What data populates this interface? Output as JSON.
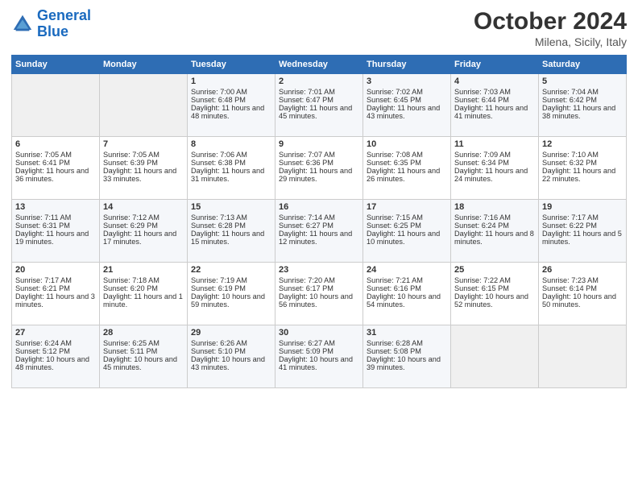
{
  "logo": {
    "line1": "General",
    "line2": "Blue"
  },
  "title": "October 2024",
  "subtitle": "Milena, Sicily, Italy",
  "days_of_week": [
    "Sunday",
    "Monday",
    "Tuesday",
    "Wednesday",
    "Thursday",
    "Friday",
    "Saturday"
  ],
  "weeks": [
    [
      {
        "day": "",
        "sunrise": "",
        "sunset": "",
        "daylight": "",
        "empty": true
      },
      {
        "day": "",
        "sunrise": "",
        "sunset": "",
        "daylight": "",
        "empty": true
      },
      {
        "day": "1",
        "sunrise": "Sunrise: 7:00 AM",
        "sunset": "Sunset: 6:48 PM",
        "daylight": "Daylight: 11 hours and 48 minutes.",
        "empty": false
      },
      {
        "day": "2",
        "sunrise": "Sunrise: 7:01 AM",
        "sunset": "Sunset: 6:47 PM",
        "daylight": "Daylight: 11 hours and 45 minutes.",
        "empty": false
      },
      {
        "day": "3",
        "sunrise": "Sunrise: 7:02 AM",
        "sunset": "Sunset: 6:45 PM",
        "daylight": "Daylight: 11 hours and 43 minutes.",
        "empty": false
      },
      {
        "day": "4",
        "sunrise": "Sunrise: 7:03 AM",
        "sunset": "Sunset: 6:44 PM",
        "daylight": "Daylight: 11 hours and 41 minutes.",
        "empty": false
      },
      {
        "day": "5",
        "sunrise": "Sunrise: 7:04 AM",
        "sunset": "Sunset: 6:42 PM",
        "daylight": "Daylight: 11 hours and 38 minutes.",
        "empty": false
      }
    ],
    [
      {
        "day": "6",
        "sunrise": "Sunrise: 7:05 AM",
        "sunset": "Sunset: 6:41 PM",
        "daylight": "Daylight: 11 hours and 36 minutes.",
        "empty": false
      },
      {
        "day": "7",
        "sunrise": "Sunrise: 7:05 AM",
        "sunset": "Sunset: 6:39 PM",
        "daylight": "Daylight: 11 hours and 33 minutes.",
        "empty": false
      },
      {
        "day": "8",
        "sunrise": "Sunrise: 7:06 AM",
        "sunset": "Sunset: 6:38 PM",
        "daylight": "Daylight: 11 hours and 31 minutes.",
        "empty": false
      },
      {
        "day": "9",
        "sunrise": "Sunrise: 7:07 AM",
        "sunset": "Sunset: 6:36 PM",
        "daylight": "Daylight: 11 hours and 29 minutes.",
        "empty": false
      },
      {
        "day": "10",
        "sunrise": "Sunrise: 7:08 AM",
        "sunset": "Sunset: 6:35 PM",
        "daylight": "Daylight: 11 hours and 26 minutes.",
        "empty": false
      },
      {
        "day": "11",
        "sunrise": "Sunrise: 7:09 AM",
        "sunset": "Sunset: 6:34 PM",
        "daylight": "Daylight: 11 hours and 24 minutes.",
        "empty": false
      },
      {
        "day": "12",
        "sunrise": "Sunrise: 7:10 AM",
        "sunset": "Sunset: 6:32 PM",
        "daylight": "Daylight: 11 hours and 22 minutes.",
        "empty": false
      }
    ],
    [
      {
        "day": "13",
        "sunrise": "Sunrise: 7:11 AM",
        "sunset": "Sunset: 6:31 PM",
        "daylight": "Daylight: 11 hours and 19 minutes.",
        "empty": false
      },
      {
        "day": "14",
        "sunrise": "Sunrise: 7:12 AM",
        "sunset": "Sunset: 6:29 PM",
        "daylight": "Daylight: 11 hours and 17 minutes.",
        "empty": false
      },
      {
        "day": "15",
        "sunrise": "Sunrise: 7:13 AM",
        "sunset": "Sunset: 6:28 PM",
        "daylight": "Daylight: 11 hours and 15 minutes.",
        "empty": false
      },
      {
        "day": "16",
        "sunrise": "Sunrise: 7:14 AM",
        "sunset": "Sunset: 6:27 PM",
        "daylight": "Daylight: 11 hours and 12 minutes.",
        "empty": false
      },
      {
        "day": "17",
        "sunrise": "Sunrise: 7:15 AM",
        "sunset": "Sunset: 6:25 PM",
        "daylight": "Daylight: 11 hours and 10 minutes.",
        "empty": false
      },
      {
        "day": "18",
        "sunrise": "Sunrise: 7:16 AM",
        "sunset": "Sunset: 6:24 PM",
        "daylight": "Daylight: 11 hours and 8 minutes.",
        "empty": false
      },
      {
        "day": "19",
        "sunrise": "Sunrise: 7:17 AM",
        "sunset": "Sunset: 6:22 PM",
        "daylight": "Daylight: 11 hours and 5 minutes.",
        "empty": false
      }
    ],
    [
      {
        "day": "20",
        "sunrise": "Sunrise: 7:17 AM",
        "sunset": "Sunset: 6:21 PM",
        "daylight": "Daylight: 11 hours and 3 minutes.",
        "empty": false
      },
      {
        "day": "21",
        "sunrise": "Sunrise: 7:18 AM",
        "sunset": "Sunset: 6:20 PM",
        "daylight": "Daylight: 11 hours and 1 minute.",
        "empty": false
      },
      {
        "day": "22",
        "sunrise": "Sunrise: 7:19 AM",
        "sunset": "Sunset: 6:19 PM",
        "daylight": "Daylight: 10 hours and 59 minutes.",
        "empty": false
      },
      {
        "day": "23",
        "sunrise": "Sunrise: 7:20 AM",
        "sunset": "Sunset: 6:17 PM",
        "daylight": "Daylight: 10 hours and 56 minutes.",
        "empty": false
      },
      {
        "day": "24",
        "sunrise": "Sunrise: 7:21 AM",
        "sunset": "Sunset: 6:16 PM",
        "daylight": "Daylight: 10 hours and 54 minutes.",
        "empty": false
      },
      {
        "day": "25",
        "sunrise": "Sunrise: 7:22 AM",
        "sunset": "Sunset: 6:15 PM",
        "daylight": "Daylight: 10 hours and 52 minutes.",
        "empty": false
      },
      {
        "day": "26",
        "sunrise": "Sunrise: 7:23 AM",
        "sunset": "Sunset: 6:14 PM",
        "daylight": "Daylight: 10 hours and 50 minutes.",
        "empty": false
      }
    ],
    [
      {
        "day": "27",
        "sunrise": "Sunrise: 6:24 AM",
        "sunset": "Sunset: 5:12 PM",
        "daylight": "Daylight: 10 hours and 48 minutes.",
        "empty": false
      },
      {
        "day": "28",
        "sunrise": "Sunrise: 6:25 AM",
        "sunset": "Sunset: 5:11 PM",
        "daylight": "Daylight: 10 hours and 45 minutes.",
        "empty": false
      },
      {
        "day": "29",
        "sunrise": "Sunrise: 6:26 AM",
        "sunset": "Sunset: 5:10 PM",
        "daylight": "Daylight: 10 hours and 43 minutes.",
        "empty": false
      },
      {
        "day": "30",
        "sunrise": "Sunrise: 6:27 AM",
        "sunset": "Sunset: 5:09 PM",
        "daylight": "Daylight: 10 hours and 41 minutes.",
        "empty": false
      },
      {
        "day": "31",
        "sunrise": "Sunrise: 6:28 AM",
        "sunset": "Sunset: 5:08 PM",
        "daylight": "Daylight: 10 hours and 39 minutes.",
        "empty": false
      },
      {
        "day": "",
        "sunrise": "",
        "sunset": "",
        "daylight": "",
        "empty": true
      },
      {
        "day": "",
        "sunrise": "",
        "sunset": "",
        "daylight": "",
        "empty": true
      }
    ]
  ]
}
